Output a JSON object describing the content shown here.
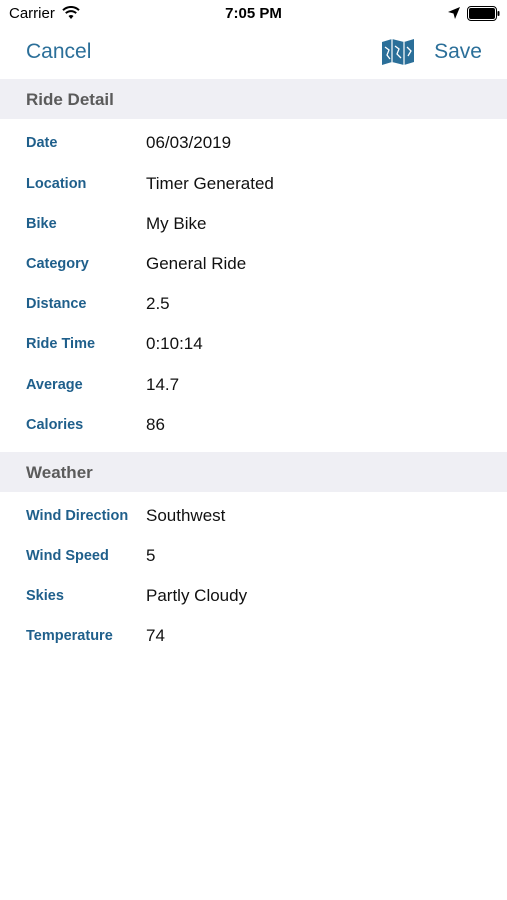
{
  "status": {
    "carrier": "Carrier",
    "time": "7:05 PM"
  },
  "nav": {
    "cancel": "Cancel",
    "save": "Save",
    "map_icon": "map-icon"
  },
  "accent_color": "#2b6f99",
  "sections": {
    "ride": {
      "title": "Ride Detail",
      "rows": [
        {
          "label": "Date",
          "value": "06/03/2019"
        },
        {
          "label": "Location",
          "value": "Timer Generated"
        },
        {
          "label": "Bike",
          "value": "My Bike"
        },
        {
          "label": "Category",
          "value": "General Ride"
        },
        {
          "label": "Distance",
          "value": "2.5"
        },
        {
          "label": "Ride Time",
          "value": "0:10:14"
        },
        {
          "label": "Average",
          "value": "14.7"
        },
        {
          "label": "Calories",
          "value": "86"
        }
      ]
    },
    "weather": {
      "title": "Weather",
      "rows": [
        {
          "label": "Wind Direction",
          "value": "Southwest"
        },
        {
          "label": "Wind Speed",
          "value": "5"
        },
        {
          "label": "Skies",
          "value": "Partly Cloudy"
        },
        {
          "label": "Temperature",
          "value": "74"
        }
      ]
    }
  }
}
